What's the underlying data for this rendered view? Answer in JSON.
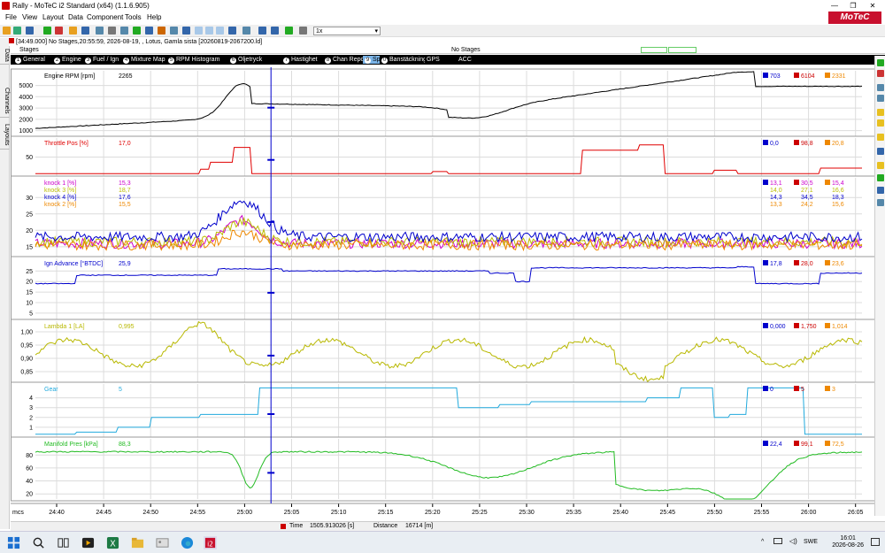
{
  "window": {
    "title": "Rally - MoTeC i2 Standard (x64) (1.1.6.905)",
    "controls": [
      "—",
      "❐",
      "✕"
    ]
  },
  "menu": [
    "File",
    "View",
    "Layout",
    "Data",
    "Component",
    "Tools",
    "Help"
  ],
  "logo": "MoTeC",
  "toolbar": {
    "zoom_value": "1x"
  },
  "file_info": "[34:49.000] No Stages,20:55:59, 2026-08-19, , Lotus, Gamla sista [20260819-2067200.ld]",
  "left_tabs": [
    "Data",
    "Channels",
    "Layouts"
  ],
  "stages": {
    "label": "Stages",
    "value": "No Stages"
  },
  "worksheet_tabs": [
    {
      "num": "1",
      "label": "General"
    },
    {
      "num": "2",
      "label": "Engine"
    },
    {
      "num": "3",
      "label": "Fuel / Ign"
    },
    {
      "num": "4",
      "label": "Mixture Map"
    },
    {
      "num": "5",
      "label": "RPM Histogram"
    },
    {
      "num": "6",
      "label": "Oljetryck"
    },
    {
      "num": "7",
      "label": "Hastighet"
    },
    {
      "num": "8",
      "label": "Chan Report"
    },
    {
      "num": "9",
      "label": "Spare"
    },
    {
      "num": "0",
      "label": "Banstäckning"
    },
    {
      "num": "",
      "label": "GPS"
    },
    {
      "num": "",
      "label": "ACC"
    }
  ],
  "active_tab": 8,
  "cursor_time_fraction": 0.285,
  "graphs": [
    {
      "channels": [
        {
          "name": "Engine RPM [rpm]",
          "value": "2265",
          "color": "#000000"
        }
      ],
      "stats": [
        {
          "min": "703",
          "max": "6104",
          "avg": "2331"
        }
      ],
      "ticks": [
        "5000",
        "4000",
        "3000",
        "2000",
        "1000"
      ],
      "ymin": 500,
      "ymax": 6300
    },
    {
      "channels": [
        {
          "name": "Throttle Pos [%]",
          "value": "17,0",
          "color": "#e00000"
        }
      ],
      "stats": [
        {
          "min": "0,0",
          "max": "98,8",
          "avg": "20,8"
        }
      ],
      "ticks": [
        "50"
      ],
      "ymin": -5,
      "ymax": 105
    },
    {
      "channels": [
        {
          "name": "knock 1 [%]",
          "value": "15,3",
          "color": "#cc00cc"
        },
        {
          "name": "knock 3 [%]",
          "value": "18,7",
          "color": "#bbbb00"
        },
        {
          "name": "knock 4 [%]",
          "value": "17,6",
          "color": "#0000cc"
        },
        {
          "name": "knock 2 [%]",
          "value": "15,5",
          "color": "#ee8800"
        }
      ],
      "stats": [
        {
          "min": "13,1",
          "max": "30,5",
          "avg": "15,4"
        },
        {
          "min": "14,0",
          "max": "27,1",
          "avg": "16,6"
        },
        {
          "min": "14,3",
          "max": "34,5",
          "avg": "18,3"
        },
        {
          "min": "13,3",
          "max": "24,2",
          "avg": "15,6"
        }
      ],
      "ticks": [
        "30",
        "25",
        "20",
        "15"
      ],
      "ymin": 12,
      "ymax": 36
    },
    {
      "channels": [
        {
          "name": "Ign Advance [°BTDC]",
          "value": "25,9",
          "color": "#0000cc"
        }
      ],
      "stats": [
        {
          "min": "17,8",
          "max": "28,0",
          "avg": "23,6"
        }
      ],
      "ticks": [
        "25",
        "20",
        "15",
        "10",
        "5"
      ],
      "ymin": 2,
      "ymax": 31
    },
    {
      "channels": [
        {
          "name": "Lambda 1 [LA]",
          "value": "0,995",
          "color": "#b8b800"
        }
      ],
      "stats": [
        {
          "min": "0,000",
          "max": "1,750",
          "avg": "1,014"
        }
      ],
      "ticks": [
        "1,00",
        "0,95",
        "0,90",
        "0,85"
      ],
      "ymin": 0.81,
      "ymax": 1.04
    },
    {
      "channels": [
        {
          "name": "Gear",
          "value": "5",
          "color": "#22aadd"
        }
      ],
      "stats": [
        {
          "min": "0",
          "max": "5",
          "avg": "3"
        }
      ],
      "ticks": [
        "4",
        "3",
        "2",
        "1"
      ],
      "ymin": 0,
      "ymax": 5.4
    },
    {
      "channels": [
        {
          "name": "Manifold Pres [kPa]",
          "value": "88,3",
          "color": "#22bb22"
        }
      ],
      "stats": [
        {
          "min": "22,4",
          "max": "99,1",
          "avg": "72,5"
        }
      ],
      "ticks": [
        "80",
        "60",
        "40",
        "20"
      ],
      "ymin": 12,
      "ymax": 105
    }
  ],
  "time_axis": {
    "unit": "mcs",
    "ticks": [
      "24:40",
      "24:45",
      "24:50",
      "24:55",
      "25:00",
      "25:05",
      "25:10",
      "25:15",
      "25:20",
      "25:25",
      "25:30",
      "25:35",
      "25:40",
      "25:45",
      "25:50",
      "25:55",
      "26:00",
      "26:05"
    ]
  },
  "status": {
    "time_label": "Time",
    "time_value": "1505.913026 [s]",
    "distance_label": "Distance",
    "distance_value": "16714 [m]"
  },
  "taskbar": {
    "lang": "SWE",
    "time": "16:01",
    "date": "2026-08-26"
  },
  "colors": {
    "tab_bg": "#000000",
    "tab_active": "#7ab4e8",
    "stat_min": "#0000cc",
    "stat_max": "#cc0000",
    "stat_avg": "#ee8800",
    "cursor": "#0000cc"
  }
}
